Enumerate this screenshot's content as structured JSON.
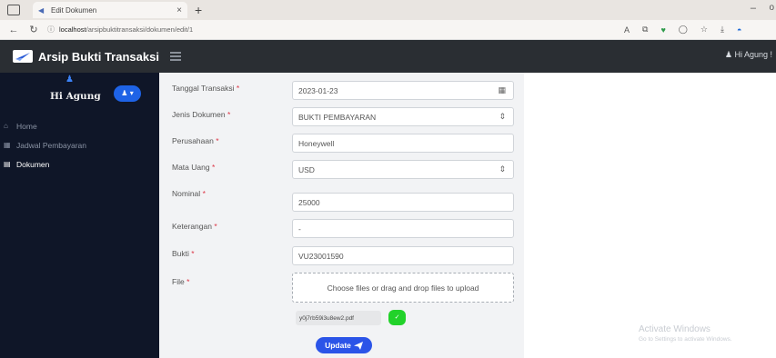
{
  "browser": {
    "tab_title": "Edit Dokumen",
    "tab_close": "×",
    "new_tab": "+",
    "win_minimize": "–",
    "win_extra": "o",
    "url_host": "localhost",
    "url_path": "/arsipbuktitransaksi/dokumen/edit/1",
    "read_aloud_label": "A"
  },
  "navbar": {
    "brand": "Arsip Bukti Transaksi",
    "user_menu": "Hi Agung !"
  },
  "sidebar": {
    "greeting": "Hi Agung",
    "badge_caret": "▾",
    "items": [
      {
        "label": "Home",
        "icon": "home-icon"
      },
      {
        "label": "Jadwal Pembayaran",
        "icon": "calendar-icon"
      },
      {
        "label": "Dokumen",
        "icon": "document-icon"
      }
    ]
  },
  "form": {
    "required_mark": "*",
    "fields": {
      "tanggal": {
        "label": "Tanggal Transaksi",
        "value": "2023-01-23"
      },
      "jenis": {
        "label": "Jenis Dokumen",
        "value": "BUKTI PEMBAYARAN"
      },
      "perusahaan": {
        "label": "Perusahaan",
        "value": "Honeywell"
      },
      "mata_uang": {
        "label": "Mata Uang",
        "value": "USD"
      },
      "nominal": {
        "label": "Nominal",
        "value": "25000"
      },
      "keterangan": {
        "label": "Keterangan",
        "value": "-"
      },
      "bukti": {
        "label": "Bukti",
        "value": "VU23001590"
      },
      "file": {
        "label": "File"
      }
    },
    "dropzone_text": "Choose files or drag and drop files to upload",
    "file_chip": "y0j7rb59i3u8ew2.pdf",
    "update_label": "Update"
  },
  "watermark": {
    "title": "Activate Windows",
    "subtitle": "Go to Settings to activate Windows."
  },
  "colors": {
    "navbar": "#2a2e33",
    "sidebar": "#0f1628",
    "primary": "#2b54e8",
    "success": "#22d22a",
    "required": "#dc3545"
  }
}
